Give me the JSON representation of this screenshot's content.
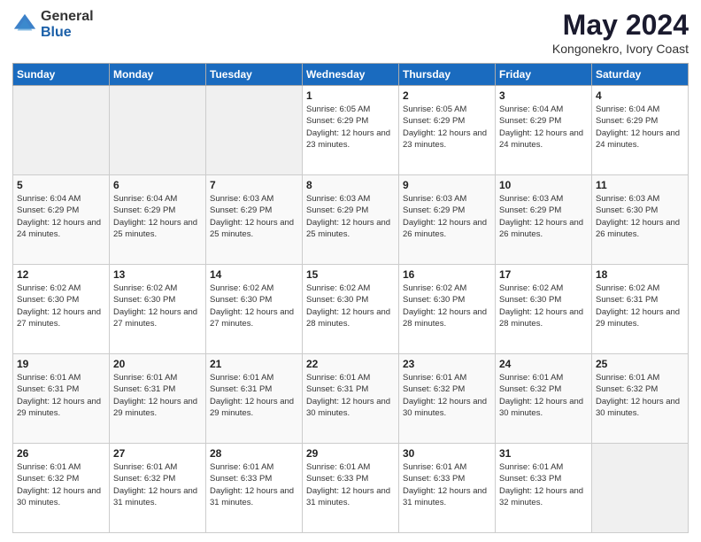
{
  "header": {
    "logo_general": "General",
    "logo_blue": "Blue",
    "month_title": "May 2024",
    "location": "Kongonekro, Ivory Coast"
  },
  "days_of_week": [
    "Sunday",
    "Monday",
    "Tuesday",
    "Wednesday",
    "Thursday",
    "Friday",
    "Saturday"
  ],
  "weeks": [
    [
      {
        "day": "",
        "info": ""
      },
      {
        "day": "",
        "info": ""
      },
      {
        "day": "",
        "info": ""
      },
      {
        "day": "1",
        "info": "Sunrise: 6:05 AM\nSunset: 6:29 PM\nDaylight: 12 hours\nand 23 minutes."
      },
      {
        "day": "2",
        "info": "Sunrise: 6:05 AM\nSunset: 6:29 PM\nDaylight: 12 hours\nand 23 minutes."
      },
      {
        "day": "3",
        "info": "Sunrise: 6:04 AM\nSunset: 6:29 PM\nDaylight: 12 hours\nand 24 minutes."
      },
      {
        "day": "4",
        "info": "Sunrise: 6:04 AM\nSunset: 6:29 PM\nDaylight: 12 hours\nand 24 minutes."
      }
    ],
    [
      {
        "day": "5",
        "info": "Sunrise: 6:04 AM\nSunset: 6:29 PM\nDaylight: 12 hours\nand 24 minutes."
      },
      {
        "day": "6",
        "info": "Sunrise: 6:04 AM\nSunset: 6:29 PM\nDaylight: 12 hours\nand 25 minutes."
      },
      {
        "day": "7",
        "info": "Sunrise: 6:03 AM\nSunset: 6:29 PM\nDaylight: 12 hours\nand 25 minutes."
      },
      {
        "day": "8",
        "info": "Sunrise: 6:03 AM\nSunset: 6:29 PM\nDaylight: 12 hours\nand 25 minutes."
      },
      {
        "day": "9",
        "info": "Sunrise: 6:03 AM\nSunset: 6:29 PM\nDaylight: 12 hours\nand 26 minutes."
      },
      {
        "day": "10",
        "info": "Sunrise: 6:03 AM\nSunset: 6:29 PM\nDaylight: 12 hours\nand 26 minutes."
      },
      {
        "day": "11",
        "info": "Sunrise: 6:03 AM\nSunset: 6:30 PM\nDaylight: 12 hours\nand 26 minutes."
      }
    ],
    [
      {
        "day": "12",
        "info": "Sunrise: 6:02 AM\nSunset: 6:30 PM\nDaylight: 12 hours\nand 27 minutes."
      },
      {
        "day": "13",
        "info": "Sunrise: 6:02 AM\nSunset: 6:30 PM\nDaylight: 12 hours\nand 27 minutes."
      },
      {
        "day": "14",
        "info": "Sunrise: 6:02 AM\nSunset: 6:30 PM\nDaylight: 12 hours\nand 27 minutes."
      },
      {
        "day": "15",
        "info": "Sunrise: 6:02 AM\nSunset: 6:30 PM\nDaylight: 12 hours\nand 28 minutes."
      },
      {
        "day": "16",
        "info": "Sunrise: 6:02 AM\nSunset: 6:30 PM\nDaylight: 12 hours\nand 28 minutes."
      },
      {
        "day": "17",
        "info": "Sunrise: 6:02 AM\nSunset: 6:30 PM\nDaylight: 12 hours\nand 28 minutes."
      },
      {
        "day": "18",
        "info": "Sunrise: 6:02 AM\nSunset: 6:31 PM\nDaylight: 12 hours\nand 29 minutes."
      }
    ],
    [
      {
        "day": "19",
        "info": "Sunrise: 6:01 AM\nSunset: 6:31 PM\nDaylight: 12 hours\nand 29 minutes."
      },
      {
        "day": "20",
        "info": "Sunrise: 6:01 AM\nSunset: 6:31 PM\nDaylight: 12 hours\nand 29 minutes."
      },
      {
        "day": "21",
        "info": "Sunrise: 6:01 AM\nSunset: 6:31 PM\nDaylight: 12 hours\nand 29 minutes."
      },
      {
        "day": "22",
        "info": "Sunrise: 6:01 AM\nSunset: 6:31 PM\nDaylight: 12 hours\nand 30 minutes."
      },
      {
        "day": "23",
        "info": "Sunrise: 6:01 AM\nSunset: 6:32 PM\nDaylight: 12 hours\nand 30 minutes."
      },
      {
        "day": "24",
        "info": "Sunrise: 6:01 AM\nSunset: 6:32 PM\nDaylight: 12 hours\nand 30 minutes."
      },
      {
        "day": "25",
        "info": "Sunrise: 6:01 AM\nSunset: 6:32 PM\nDaylight: 12 hours\nand 30 minutes."
      }
    ],
    [
      {
        "day": "26",
        "info": "Sunrise: 6:01 AM\nSunset: 6:32 PM\nDaylight: 12 hours\nand 30 minutes."
      },
      {
        "day": "27",
        "info": "Sunrise: 6:01 AM\nSunset: 6:32 PM\nDaylight: 12 hours\nand 31 minutes."
      },
      {
        "day": "28",
        "info": "Sunrise: 6:01 AM\nSunset: 6:33 PM\nDaylight: 12 hours\nand 31 minutes."
      },
      {
        "day": "29",
        "info": "Sunrise: 6:01 AM\nSunset: 6:33 PM\nDaylight: 12 hours\nand 31 minutes."
      },
      {
        "day": "30",
        "info": "Sunrise: 6:01 AM\nSunset: 6:33 PM\nDaylight: 12 hours\nand 31 minutes."
      },
      {
        "day": "31",
        "info": "Sunrise: 6:01 AM\nSunset: 6:33 PM\nDaylight: 12 hours\nand 32 minutes."
      },
      {
        "day": "",
        "info": ""
      }
    ]
  ]
}
